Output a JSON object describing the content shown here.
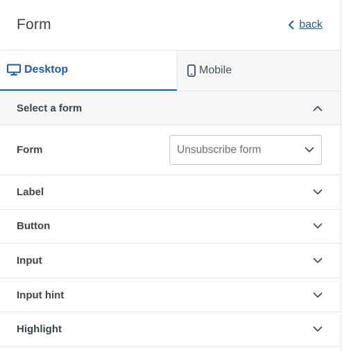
{
  "header": {
    "title": "Form",
    "back_label": "back"
  },
  "tabs": [
    {
      "label": "Desktop",
      "active": true,
      "icon": "desktop-icon"
    },
    {
      "label": "Mobile",
      "active": false,
      "icon": "mobile-icon"
    }
  ],
  "sections": {
    "select_form": {
      "label": "Select a form",
      "expanded": true
    },
    "form_field": {
      "label": "Form",
      "value": "Unsubscribe form"
    },
    "label": {
      "label": "Label"
    },
    "button": {
      "label": "Button"
    },
    "input": {
      "label": "Input"
    },
    "input_hint": {
      "label": "Input hint"
    },
    "highlight": {
      "label": "Highlight"
    }
  },
  "colors": {
    "accent": "#1f5e9c",
    "divider": "#e4e6e8",
    "muted_bg": "#f5f6f7"
  }
}
